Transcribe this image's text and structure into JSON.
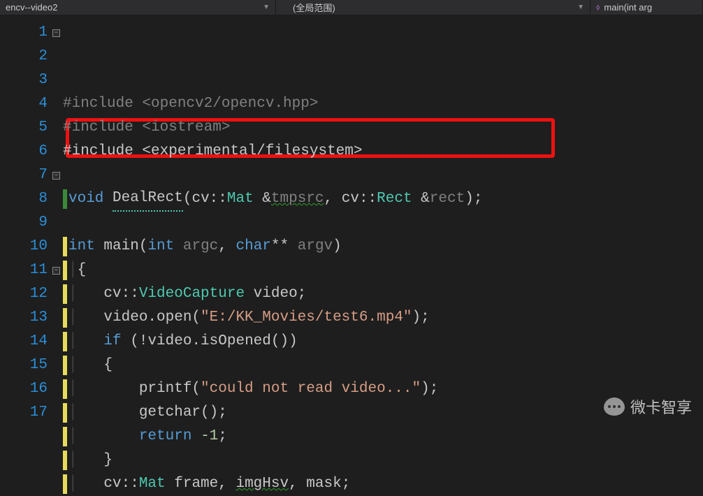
{
  "topbar": {
    "project": "encv--video2",
    "scope": "(全局范围)",
    "fn": "main(int arg"
  },
  "lines": [
    {
      "n": "1",
      "fold": "-",
      "pre": "",
      "tokens": [
        [
          "dim",
          "#include "
        ],
        [
          "dim",
          "<opencv2/opencv.hpp>"
        ]
      ]
    },
    {
      "n": "2",
      "pre": " ",
      "tokens": [
        [
          "dim",
          "#include "
        ],
        [
          "dim",
          "<iostream>"
        ]
      ]
    },
    {
      "n": "3",
      "pre": " ",
      "tokens": [
        [
          "fn",
          "#include "
        ],
        [
          "fn",
          "<experimental/filesystem>"
        ]
      ]
    },
    {
      "n": "4",
      "pre": "",
      "tokens": []
    },
    {
      "n": "5",
      "pre": " ",
      "gbar": true,
      "tokens": [
        [
          "kw",
          "void"
        ],
        [
          "fn",
          " "
        ],
        [
          "fn dot-u",
          "DealRect"
        ],
        [
          "fn",
          "(cv::"
        ],
        [
          "type",
          "Mat"
        ],
        [
          "fn",
          " &"
        ],
        [
          "dim wavy-g",
          "tmpsrc"
        ],
        [
          "fn",
          ", cv::"
        ],
        [
          "type",
          "Rect"
        ],
        [
          "fn",
          " &"
        ],
        [
          "dim",
          "rect"
        ],
        [
          "fn",
          ");"
        ]
      ]
    },
    {
      "n": "6",
      "pre": "",
      "tokens": []
    },
    {
      "n": "7",
      "ybar": true,
      "fold": "-",
      "tokens": [
        [
          "kw",
          "int"
        ],
        [
          "fn",
          " main("
        ],
        [
          "kw",
          "int"
        ],
        [
          "fn",
          " "
        ],
        [
          "dim",
          "argc"
        ],
        [
          "fn",
          ", "
        ],
        [
          "kw",
          "char"
        ],
        [
          "fn",
          "** "
        ],
        [
          "dim",
          "argv"
        ],
        [
          "fn",
          ")"
        ]
      ]
    },
    {
      "n": "8",
      "ybar": true,
      "pipe": true,
      "tokens": [
        [
          "fn",
          "{"
        ]
      ]
    },
    {
      "n": "9",
      "ybar": true,
      "pipe": true,
      "tokens": [
        [
          "fn",
          "   cv::"
        ],
        [
          "type",
          "VideoCapture"
        ],
        [
          "fn",
          " video;"
        ]
      ]
    },
    {
      "n": "10",
      "ybar": true,
      "pipe": true,
      "tokens": [
        [
          "fn",
          "   video.open("
        ],
        [
          "str",
          "\"E:/KK_Movies/test6.mp4\""
        ],
        [
          "fn",
          ");"
        ]
      ]
    },
    {
      "n": "11",
      "ybar": true,
      "pipe": true,
      "fold": "-",
      "tokens": [
        [
          "fn",
          "   "
        ],
        [
          "kw",
          "if"
        ],
        [
          "fn",
          " (!video.isOpened())"
        ]
      ]
    },
    {
      "n": "12",
      "ybar": true,
      "pipe": true,
      "tokens": [
        [
          "fn",
          "   {"
        ]
      ]
    },
    {
      "n": "13",
      "ybar": true,
      "pipe": true,
      "tokens": [
        [
          "fn",
          "       printf("
        ],
        [
          "str",
          "\"could not read video...\""
        ],
        [
          "fn",
          ");"
        ]
      ]
    },
    {
      "n": "14",
      "ybar": true,
      "pipe": true,
      "tokens": [
        [
          "fn",
          "       getchar();"
        ]
      ]
    },
    {
      "n": "15",
      "ybar": true,
      "pipe": true,
      "tokens": [
        [
          "fn",
          "       "
        ],
        [
          "kw",
          "return"
        ],
        [
          "fn",
          " "
        ],
        [
          "num",
          "-1"
        ],
        [
          "fn",
          ";"
        ]
      ]
    },
    {
      "n": "16",
      "ybar": true,
      "pipe": true,
      "tokens": [
        [
          "fn",
          "   }"
        ]
      ]
    },
    {
      "n": "17",
      "ybar": true,
      "pipe": true,
      "tokens": [
        [
          "fn",
          "   cv::"
        ],
        [
          "type",
          "Mat"
        ],
        [
          "fn",
          " frame, "
        ],
        [
          "fn wavy-g",
          "imgHsv"
        ],
        [
          "fn",
          ", mask;"
        ]
      ]
    }
  ],
  "watermark": "微卡智享"
}
